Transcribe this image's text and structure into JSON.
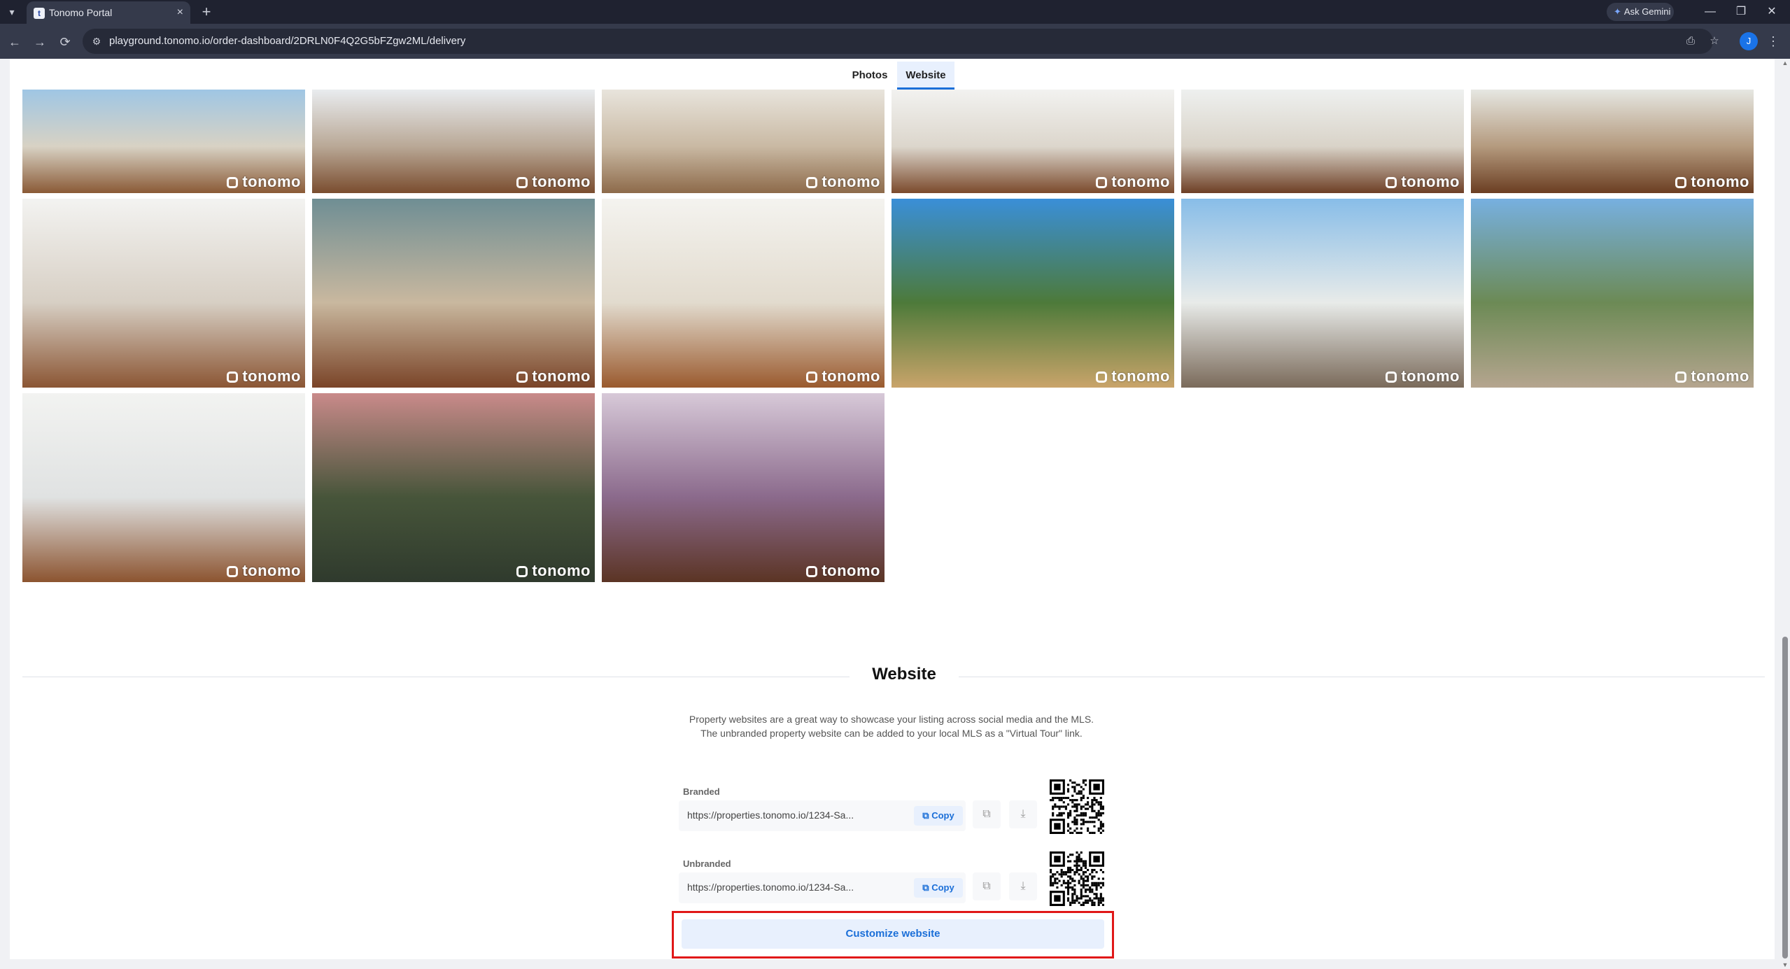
{
  "browser": {
    "tab_title": "Tonomo Portal",
    "tab_favicon": "t",
    "url": "playground.tonomo.io/order-dashboard/2DRLN0F4Q2G5bFZgw2ML/delivery",
    "ask_gemini": "Ask Gemini",
    "profile_initial": "J",
    "icons": {
      "tab_menu": "▾",
      "close": "×",
      "new_tab": "+",
      "gemini": "✦",
      "minimize": "—",
      "restore": "❐",
      "window_close": "✕",
      "back": "←",
      "forward": "→",
      "reload": "⟳",
      "site_info": "⚙",
      "install": "⎙",
      "bookmark": "☆",
      "menu": "⋮"
    }
  },
  "tabs": [
    {
      "label": "Photos",
      "active": false
    },
    {
      "label": "Website",
      "active": true
    }
  ],
  "gallery": {
    "watermark": "tonomo",
    "rows": [
      [
        {
          "name": "deck-dining-table",
          "colors": [
            "#9fc6e4",
            "#d8d2c4",
            "#8a5a36"
          ]
        },
        {
          "name": "porch-wicker-chairs",
          "colors": [
            "#e9ecef",
            "#b9a896",
            "#7a4d2f"
          ]
        },
        {
          "name": "living-room-fireplace",
          "colors": [
            "#e8e4dc",
            "#c9b9a3",
            "#8d6a4a"
          ]
        },
        {
          "name": "kitchen-island-1",
          "colors": [
            "#f2f2f0",
            "#dcd6cc",
            "#7b4a2c"
          ]
        },
        {
          "name": "kitchen-island-2",
          "colors": [
            "#eef0ef",
            "#d9d3c8",
            "#6e3f25"
          ]
        },
        {
          "name": "dining-round-table",
          "colors": [
            "#e6e7e2",
            "#b49a7e",
            "#6b3e22"
          ]
        }
      ],
      [
        {
          "name": "entry-console",
          "colors": [
            "#f3f3f1",
            "#d7cfc4",
            "#8b5634"
          ]
        },
        {
          "name": "hallway-wallpaper",
          "colors": [
            "#6f8e94",
            "#c9b89f",
            "#7a4428"
          ]
        },
        {
          "name": "chandelier-stairs",
          "colors": [
            "#f4f3ef",
            "#e2dbce",
            "#9a5a2e"
          ]
        },
        {
          "name": "garden-palms",
          "colors": [
            "#3a8fd8",
            "#4d7a3a",
            "#c9a46a"
          ]
        },
        {
          "name": "veranda-view",
          "colors": [
            "#88bde8",
            "#e8ebe9",
            "#7a6a5a"
          ]
        },
        {
          "name": "adirondack-chairs",
          "colors": [
            "#77b0e0",
            "#6c8a55",
            "#b5a58f"
          ]
        }
      ],
      [
        {
          "name": "front-door",
          "colors": [
            "#f2f3f1",
            "#e0e2e2",
            "#8c5430"
          ]
        },
        {
          "name": "aerial-sunset",
          "colors": [
            "#c98a8a",
            "#47553a",
            "#2f3a2d"
          ]
        },
        {
          "name": "balcony-dusk",
          "colors": [
            "#d7c9d8",
            "#8b6a8c",
            "#5b3424"
          ]
        }
      ]
    ]
  },
  "website": {
    "title": "Website",
    "description": "Property websites are a great way to showcase your listing across social media and the MLS. The unbranded property website can be added to your local MLS as a \"Virtual Tour\" link.",
    "links": [
      {
        "label": "Branded",
        "url": "https://properties.tonomo.io/1234-Sa...",
        "copy": "Copy"
      },
      {
        "label": "Unbranded",
        "url": "https://properties.tonomo.io/1234-Sa...",
        "copy": "Copy"
      }
    ],
    "copy_icon": "⧉",
    "open_icon": "⧉",
    "download_icon": "⤓",
    "customize_label": "Customize website"
  }
}
